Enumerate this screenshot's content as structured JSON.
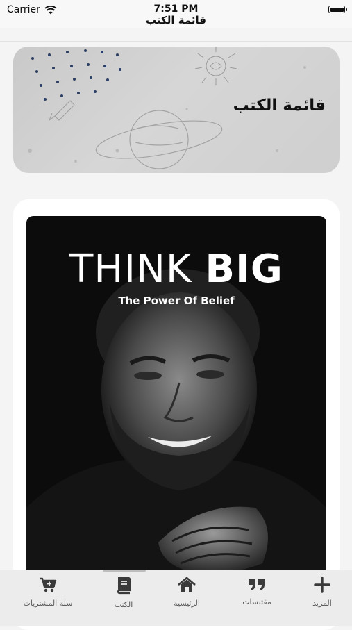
{
  "status_bar": {
    "carrier": "Carrier",
    "time": "7:51 PM"
  },
  "navigation": {
    "title": "قائمة الكتب"
  },
  "banner": {
    "title": "قائمة الكتب"
  },
  "book": {
    "cover_title_light": "THINK",
    "cover_title_bold": "BIG",
    "cover_subtitle": "The Power Of Belief"
  },
  "tab_bar": {
    "items": [
      {
        "label": "سلة المشتريات",
        "icon": "cart-icon"
      },
      {
        "label": "الكتب",
        "icon": "book-icon"
      },
      {
        "label": "الرئيسية",
        "icon": "home-icon"
      },
      {
        "label": "مقتبسات",
        "icon": "quote-icon"
      },
      {
        "label": "المزيد",
        "icon": "plus-icon"
      }
    ]
  },
  "colors": {
    "tab_icon": "#3a3a3a",
    "tab_label": "#5a5a5a",
    "banner_bg": "#cfcfcf"
  }
}
